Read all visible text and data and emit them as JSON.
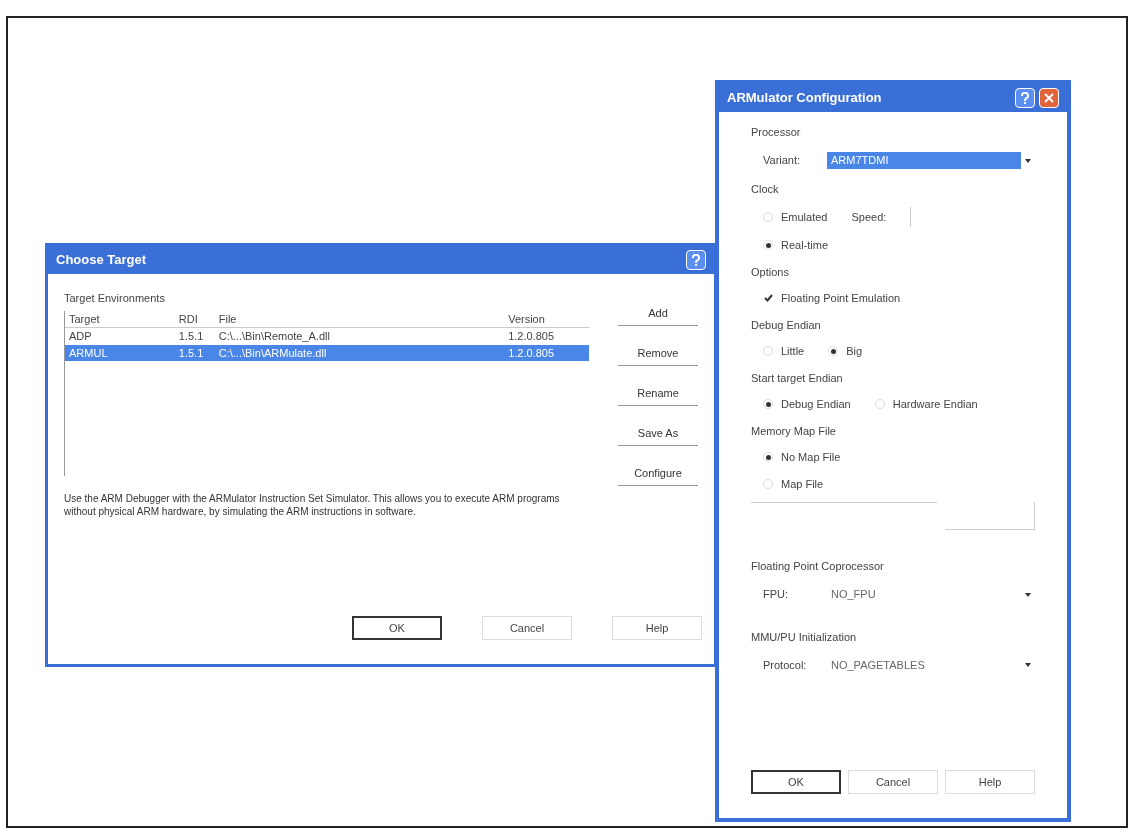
{
  "choose_target": {
    "title": "Choose Target",
    "group_label": "Target Environments",
    "columns": [
      "Target",
      "RDI",
      "File",
      "Version"
    ],
    "rows": [
      {
        "cells": [
          "ADP",
          "1.5.1",
          "C:\\...\\Bin\\Remote_A.dll",
          "1.2.0.805"
        ],
        "selected": false
      },
      {
        "cells": [
          "ARMUL",
          "1.5.1",
          "C:\\...\\Bin\\ARMulate.dll",
          "1.2.0.805"
        ],
        "selected": true
      }
    ],
    "side_buttons": [
      "Add",
      "Remove",
      "Rename",
      "Save As",
      "Configure"
    ],
    "description": "Use the ARM Debugger with the ARMulator Instruction Set Simulator. This allows you to execute ARM programs without physical ARM hardware, by simulating the ARM instructions in software.",
    "buttons": [
      {
        "label": "OK",
        "default": true
      },
      {
        "label": "Cancel",
        "default": false
      },
      {
        "label": "Help",
        "default": false
      }
    ]
  },
  "armulator": {
    "title": "ARMulator Configuration",
    "processor": {
      "heading": "Processor",
      "label": "Variant:",
      "value": "ARM7TDMI"
    },
    "clock": {
      "heading": "Clock",
      "emulated": {
        "label": "Emulated",
        "selected": false
      },
      "speed_label": "Speed:",
      "realtime": {
        "label": "Real-time",
        "selected": true
      }
    },
    "options": {
      "heading": "Options",
      "items": [
        {
          "label": "Floating Point Emulation",
          "checked": true
        }
      ]
    },
    "debug_endian": {
      "heading": "Debug Endian",
      "choices": [
        {
          "label": "Little",
          "selected": false
        },
        {
          "label": "Big",
          "selected": true
        }
      ]
    },
    "start_endian": {
      "heading": "Start target Endian",
      "choices": [
        {
          "label": "Debug Endian",
          "selected": true
        },
        {
          "label": "Hardware Endian",
          "selected": false
        }
      ]
    },
    "memory_map": {
      "heading": "Memory Map File",
      "choices": [
        {
          "label": "No Map File",
          "selected": true
        },
        {
          "label": "Map File",
          "selected": false
        }
      ]
    },
    "fpu": {
      "heading": "Floating Point Coprocessor",
      "label": "FPU:",
      "value": "NO_FPU"
    },
    "mmu": {
      "heading": "MMU/PU Initialization",
      "label": "Protocol:",
      "value": "NO_PAGETABLES"
    },
    "buttons": [
      {
        "label": "OK",
        "default": true
      },
      {
        "label": "Cancel",
        "default": false
      },
      {
        "label": "Help",
        "default": false
      }
    ]
  }
}
